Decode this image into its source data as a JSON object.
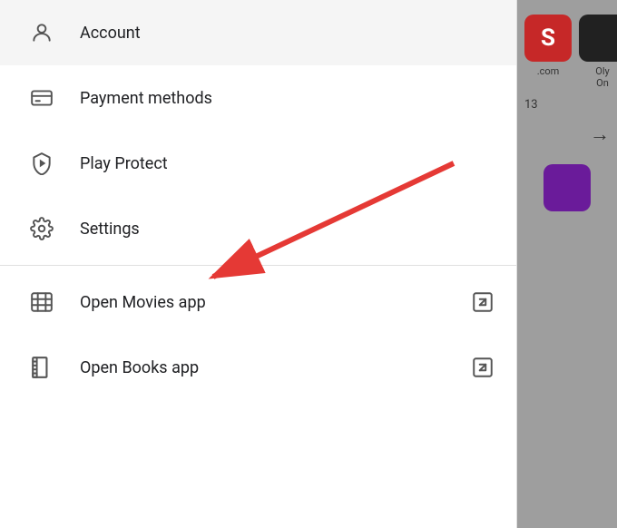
{
  "menu": {
    "items": [
      {
        "id": "account",
        "label": "Account",
        "icon": "account-icon",
        "has_external": false
      },
      {
        "id": "payment",
        "label": "Payment methods",
        "icon": "payment-icon",
        "has_external": false
      },
      {
        "id": "protect",
        "label": "Play Protect",
        "icon": "shield-icon",
        "has_external": false
      },
      {
        "id": "settings",
        "label": "Settings",
        "icon": "gear-icon",
        "has_external": false
      },
      {
        "id": "movies",
        "label": "Open Movies app",
        "icon": "movies-icon",
        "has_external": true
      },
      {
        "id": "books",
        "label": "Open Books app",
        "icon": "books-icon",
        "has_external": true
      }
    ]
  },
  "right_panel": {
    "app1_label": ".com",
    "app2_label": "Oly\nOn",
    "app3_count": "13"
  }
}
